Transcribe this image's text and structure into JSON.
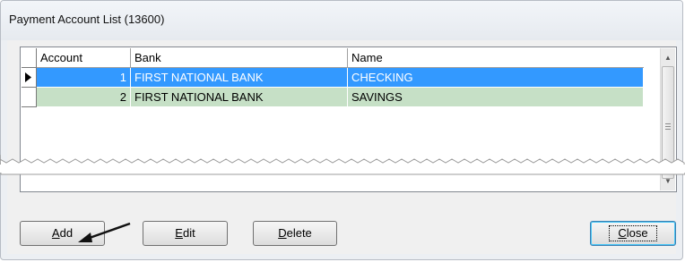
{
  "window": {
    "title": "Payment Account List (13600)"
  },
  "grid": {
    "columns": [
      "Account",
      "Bank",
      "Name"
    ],
    "rows": [
      {
        "account": "1",
        "bank": "FIRST NATIONAL BANK",
        "name": "CHECKING",
        "selected": true,
        "color": "#3399ff"
      },
      {
        "account": "2",
        "bank": "FIRST NATIONAL BANK",
        "name": "SAVINGS",
        "selected": false,
        "color": "#c6e0c6"
      }
    ]
  },
  "buttons": {
    "add": {
      "key": "A",
      "rest": "dd"
    },
    "edit": {
      "key": "E",
      "rest": "dit"
    },
    "delete": {
      "key": "D",
      "rest": "elete"
    },
    "close": {
      "key": "C",
      "rest": "lose"
    }
  },
  "annotation": {
    "icon": "arrow-pointer-icon",
    "target": "Add"
  }
}
